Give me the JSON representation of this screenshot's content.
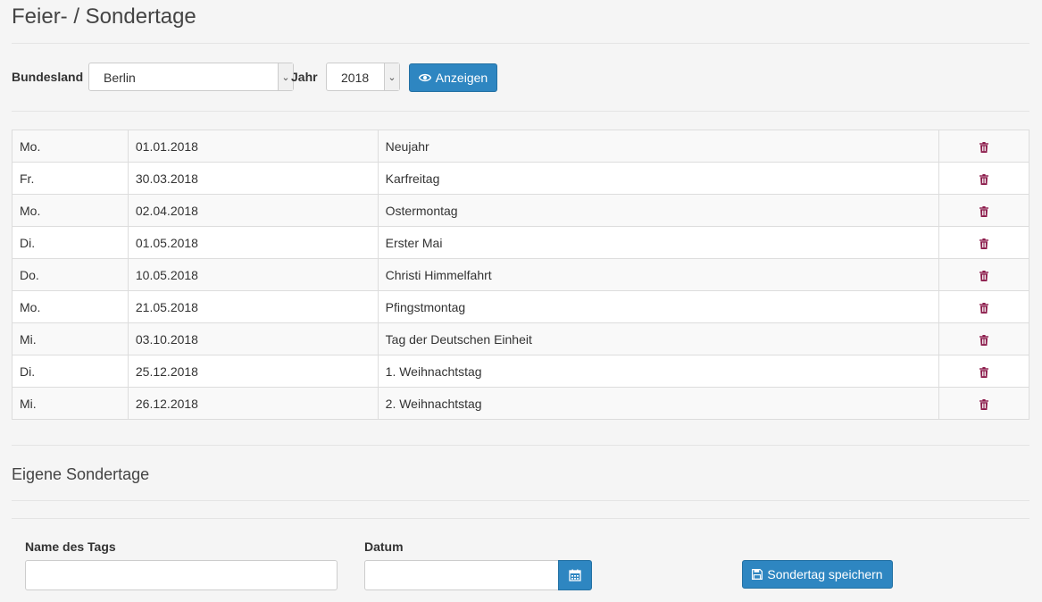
{
  "page": {
    "title": "Feier- / Sondertage"
  },
  "filter": {
    "state_label": "Bundesland",
    "state_value": "Berlin",
    "year_label": "Jahr",
    "year_value": "2018",
    "show_button": "Anzeigen"
  },
  "holidays": [
    {
      "day": "Mo.",
      "date": "01.01.2018",
      "name": "Neujahr"
    },
    {
      "day": "Fr.",
      "date": "30.03.2018",
      "name": "Karfreitag"
    },
    {
      "day": "Mo.",
      "date": "02.04.2018",
      "name": "Ostermontag"
    },
    {
      "day": "Di.",
      "date": "01.05.2018",
      "name": "Erster Mai"
    },
    {
      "day": "Do.",
      "date": "10.05.2018",
      "name": "Christi Himmelfahrt"
    },
    {
      "day": "Mo.",
      "date": "21.05.2018",
      "name": "Pfingstmontag"
    },
    {
      "day": "Mi.",
      "date": "03.10.2018",
      "name": "Tag der Deutschen Einheit"
    },
    {
      "day": "Di.",
      "date": "25.12.2018",
      "name": "1. Weihnachtstag"
    },
    {
      "day": "Mi.",
      "date": "26.12.2018",
      "name": "2. Weihnachtstag"
    }
  ],
  "custom": {
    "heading": "Eigene Sondertage",
    "name_label": "Name des Tags",
    "name_value": "",
    "date_label": "Datum",
    "date_value": "",
    "save_button": "Sondertag speichern"
  },
  "colors": {
    "primary": "#2e86c1",
    "trash": "#8b1a4a"
  },
  "icons": {
    "show": "eye-icon",
    "delete": "trash-icon",
    "calendar": "calendar-icon",
    "save": "floppy-disk-icon"
  }
}
